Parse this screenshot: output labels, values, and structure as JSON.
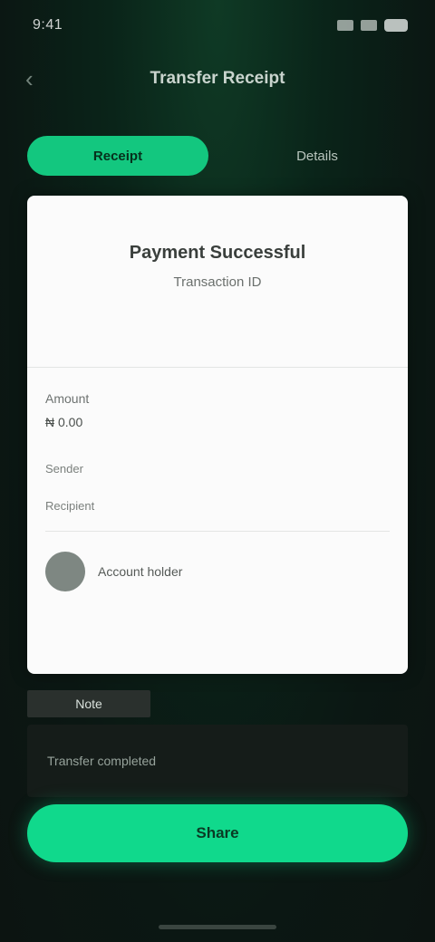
{
  "status": {
    "time": "9:41"
  },
  "header": {
    "title": "Transfer Receipt"
  },
  "tabs": [
    {
      "label": "Receipt"
    },
    {
      "label": "Details"
    }
  ],
  "card": {
    "title": "Payment Successful",
    "subtitle": "Transaction ID",
    "field_label": "Amount",
    "field_value": "₦ 0.00",
    "row1": "Sender",
    "row2": "Recipient",
    "avatar_name": "Account holder"
  },
  "info": {
    "label": "Note",
    "text": "Transfer completed"
  },
  "primary_button": {
    "label": "Share"
  }
}
